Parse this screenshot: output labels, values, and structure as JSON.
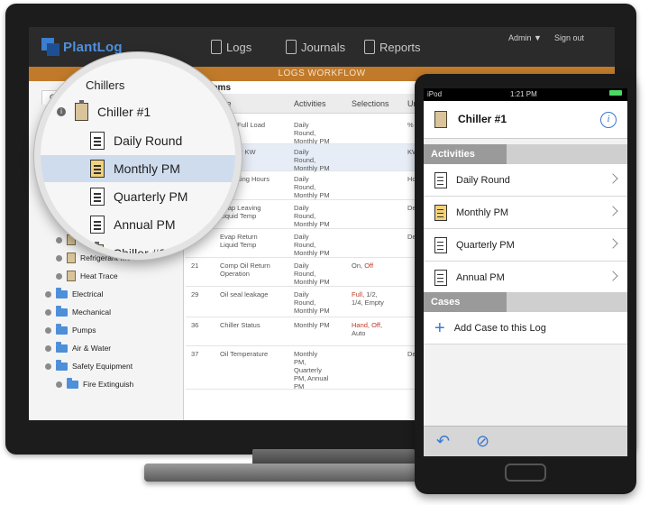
{
  "desktop": {
    "logo": "PlantLog",
    "nav": [
      "Logs",
      "Journals",
      "Reports"
    ],
    "admin": "Admin ▼",
    "signout": "Sign out",
    "workflow": "LOGS WORKFLOW",
    "tab_general": "Gene",
    "tab_logs": "Le",
    "items_label": "ems",
    "tree": [
      {
        "label": "Refrigerant Mo",
        "kind": "clip",
        "indent": 2
      },
      {
        "label": "Refrigerant Mo",
        "kind": "clip",
        "indent": 2
      },
      {
        "label": "Heat Trace",
        "kind": "clip",
        "indent": 2
      },
      {
        "label": "Electrical",
        "kind": "folder",
        "indent": 1
      },
      {
        "label": "Mechanical",
        "kind": "folder",
        "indent": 1
      },
      {
        "label": "Pumps",
        "kind": "folder",
        "indent": 1
      },
      {
        "label": "Air & Water",
        "kind": "folder",
        "indent": 1
      },
      {
        "label": "Safety Equipment",
        "kind": "folder",
        "indent": 1
      },
      {
        "label": "Fire Extinguish",
        "kind": "folder",
        "indent": 2
      }
    ],
    "grid_headers": {
      "name": "me",
      "activities": "Activities",
      "selections": "Selections",
      "units": "Uni"
    },
    "rows": [
      {
        "num": "",
        "name": "rgent Full Load\nps",
        "act": "Daily\nRound,\nMonthly PM",
        "sel": "",
        "sel_red": "",
        "sel_tail": "",
        "unit": "%"
      },
      {
        "num": "",
        "name": "t Power KW",
        "act": "Daily\nRound,\nMonthly PM",
        "sel": "",
        "sel_red": "",
        "sel_tail": "",
        "unit": "KW"
      },
      {
        "num": "",
        "name": "Operating Hours",
        "act": "Daily\nRound,\nMonthly PM",
        "sel": "",
        "sel_red": "",
        "sel_tail": "",
        "unit": "Hou"
      },
      {
        "num": "",
        "name": "Evap Leaving\nLiquid Temp",
        "act": "Daily\nRound,\nMonthly PM",
        "sel": "",
        "sel_red": "",
        "sel_tail": "",
        "unit": "Deg"
      },
      {
        "num": "5",
        "name": "Evap Return\nLiquid Temp",
        "act": "Daily\nRound,\nMonthly PM",
        "sel": "",
        "sel_red": "",
        "sel_tail": "",
        "unit": "Deg"
      },
      {
        "num": "21",
        "name": "Comp Oil Return\nOperation",
        "act": "Daily\nRound,\nMonthly PM",
        "sel": "On, ",
        "sel_red": "Off",
        "sel_tail": "",
        "unit": ""
      },
      {
        "num": "29",
        "name": "Oil seal leakage",
        "act": "Daily\nRound,\nMonthly PM",
        "sel": "",
        "sel_red": "Full",
        "sel_tail": ", 1/2,\n1/4, Empty",
        "unit": ""
      },
      {
        "num": "36",
        "name": "Chiller Status",
        "act": "Monthly PM",
        "sel": "",
        "sel_red": "Hand, Off",
        "sel_tail": ",\nAuto",
        "unit": ""
      },
      {
        "num": "37",
        "name": "Oil Temperature",
        "act": "Monthly\nPM,\nQuarterly\nPM, Annual\nPM",
        "sel": "",
        "sel_red": "",
        "sel_tail": "",
        "unit": "Deg"
      }
    ]
  },
  "magnifier": {
    "chillers": "Chillers",
    "chiller1": "Chiller #1",
    "items": [
      "Daily Round",
      "Monthly PM",
      "Quarterly PM",
      "Annual PM"
    ],
    "chiller2": "Chiller #2"
  },
  "phone": {
    "carrier": "iPod",
    "time": "1:21 PM",
    "title": "Chiller #1",
    "activities_header": "Activities",
    "activities": [
      "Daily Round",
      "Monthly PM",
      "Quarterly PM",
      "Annual PM"
    ],
    "cases_header": "Cases",
    "add_case": "Add Case to this Log"
  }
}
